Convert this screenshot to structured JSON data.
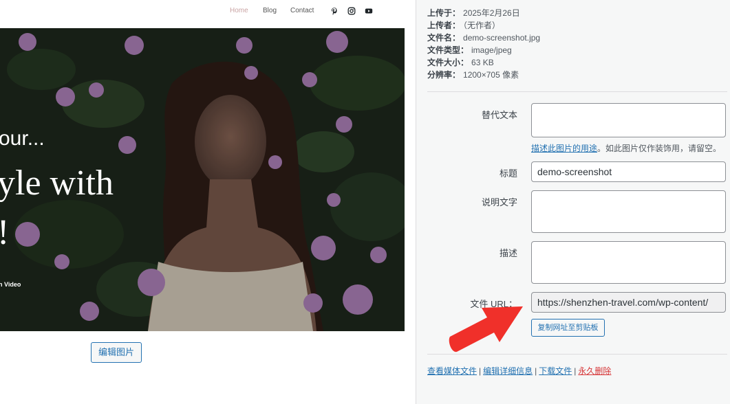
{
  "site_nav": {
    "home": "Home",
    "blog": "Blog",
    "contact": "Contact",
    "social_icons": [
      "pinterest-icon",
      "instagram-icon",
      "youtube-icon"
    ],
    "active_color": "#c9a3a3"
  },
  "hero": {
    "line1": "our...",
    "line2": "yle with",
    "line3": "!",
    "line4": "n Video"
  },
  "edit_image_label": "编辑图片",
  "meta": {
    "uploaded_on_label": "上传于：",
    "uploaded_on": "2025年2月26日",
    "uploaded_by_label": "上传者：",
    "uploaded_by": "（无作者）",
    "file_name_label": "文件名：",
    "file_name": "demo-screenshot.jpg",
    "file_type_label": "文件类型：",
    "file_type": "image/jpeg",
    "file_size_label": "文件大小：",
    "file_size": "63 KB",
    "dimensions_label": "分辨率：",
    "dimensions": "1200×705 像素"
  },
  "fields": {
    "alt_label": "替代文本",
    "alt_value": "",
    "alt_help_link": "描述此图片的用途",
    "alt_help_text": "。如此图片仅作装饰用，请留空。",
    "title_label": "标题",
    "title_value": "demo-screenshot",
    "caption_label": "说明文字",
    "caption_value": "",
    "description_label": "描述",
    "description_value": "",
    "url_label": "文件 URL：",
    "url_value": "https://shenzhen-travel.com/wp-content/",
    "copy_button": "复制网址至剪贴板"
  },
  "actions": {
    "view": "查看媒体文件",
    "edit": "编辑详细信息",
    "download": "下载文件",
    "delete": "永久删除",
    "separator": "|"
  },
  "colors": {
    "link": "#2271b1",
    "danger": "#d63638",
    "annotation_arrow": "#f0302a"
  }
}
